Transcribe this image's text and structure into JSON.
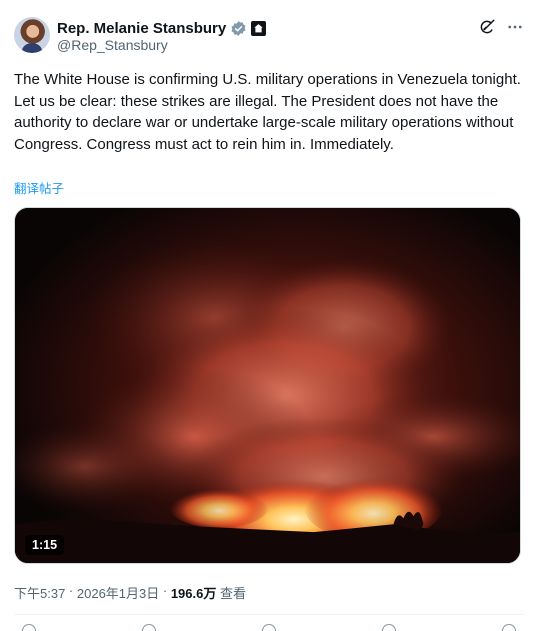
{
  "author": {
    "display_name": "Rep. Melanie Stansbury",
    "handle": "@Rep_Stansbury",
    "avatar_icon": "avatar",
    "badges": [
      "verified-icon",
      "government-badge-icon"
    ],
    "verified_color": "#829aab"
  },
  "post": {
    "text": "The White House is confirming U.S. military operations in Venezuela tonight. Let us be clear: these strikes are illegal. The President does not have the authority to declare war or undertake large-scale military operations without Congress. Congress must act to rein him in. Immediately.",
    "translate_label": "翻译帖子"
  },
  "media": {
    "type": "video",
    "duration": "1:15"
  },
  "meta": {
    "time": "下午5:37",
    "separator1": " · ",
    "date": "2026年1月3日",
    "separator2": " · ",
    "views_count": "196.6万",
    "views_label": " 查看"
  },
  "header_actions": {
    "grok_icon": "grok-icon",
    "more_icon": "more-icon"
  },
  "colors": {
    "link": "#1d9bf0",
    "secondary_text": "#536471",
    "primary_text": "#0f1419"
  }
}
